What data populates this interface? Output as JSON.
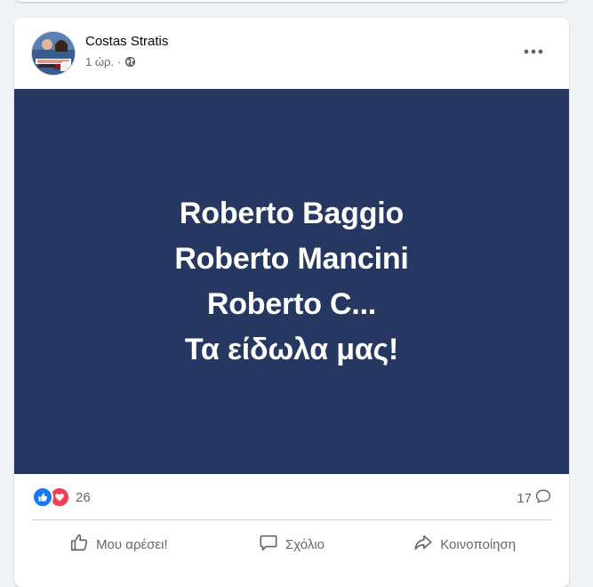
{
  "post": {
    "author": "Costas Stratis",
    "time": "1 ώρ.",
    "separator": "·",
    "banner_lines": [
      "Roberto Baggio",
      "Roberto Mancini",
      "Roberto C...",
      "Τα είδωλα μας!"
    ],
    "reaction_count": "26",
    "comment_count": "17",
    "actions": {
      "like": "Μου αρέσει!",
      "comment": "Σχόλιο",
      "share": "Κοινοποίηση"
    }
  },
  "colors": {
    "banner_bg": "#263762",
    "like_blue": "#1877f2",
    "love_red": "#f33e58",
    "secondary_text": "#65676b"
  },
  "icons": [
    "globe-icon",
    "more-icon",
    "like-reaction-icon",
    "love-reaction-icon",
    "comment-bubble-icon",
    "thumbs-up-icon",
    "comment-icon",
    "share-icon"
  ]
}
